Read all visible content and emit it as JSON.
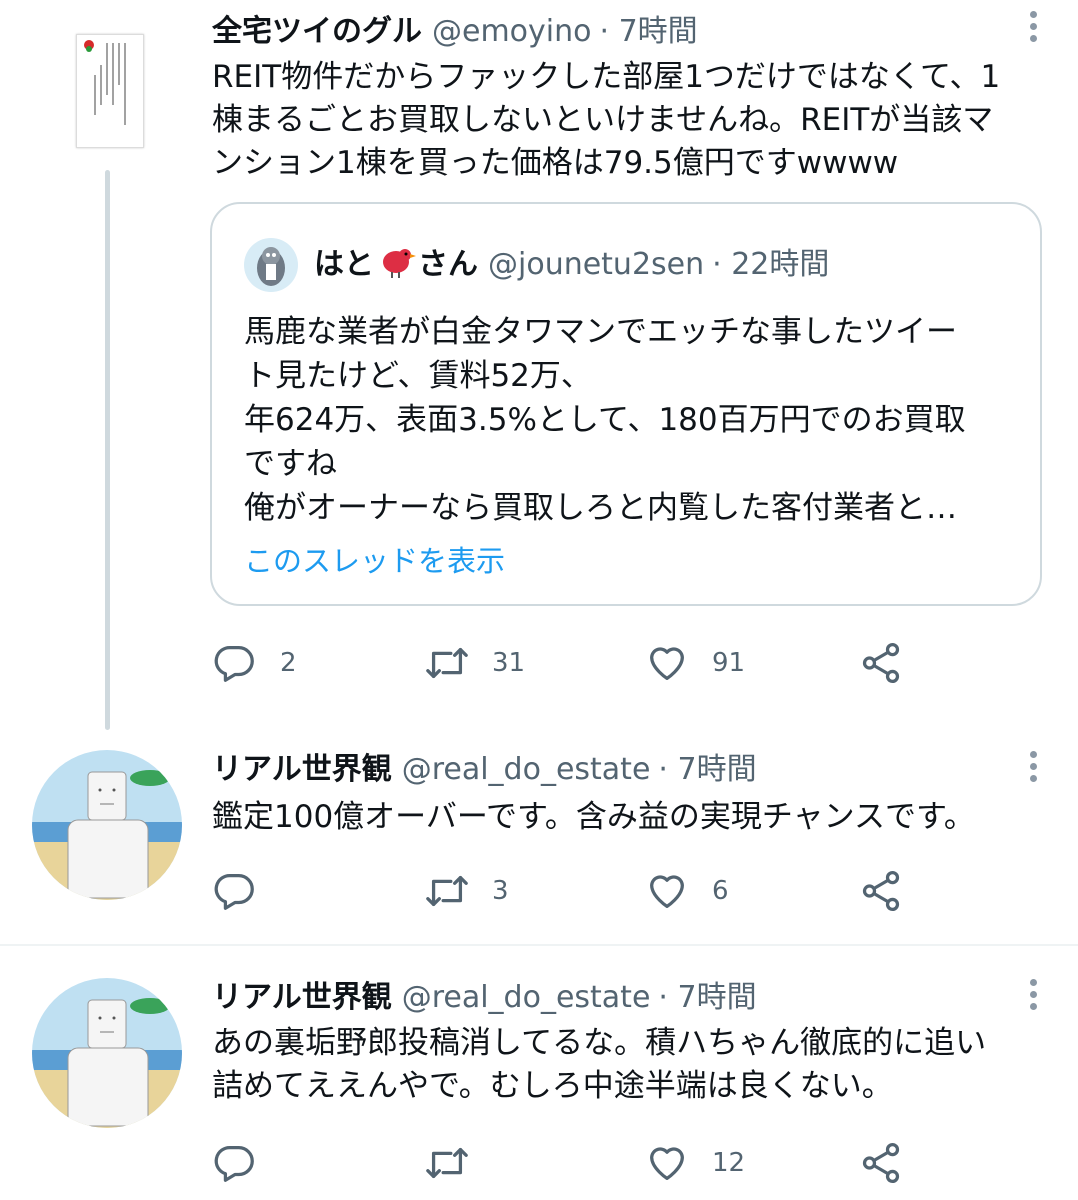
{
  "tweets": [
    {
      "name": "全宅ツイのグル",
      "handle": "@emoyino",
      "time": "· 7時間",
      "text_lines": [
        "REIT物件だからファックした部屋1つだけではなくて、1",
        "棟まるごとお買取しないといけませんね。REITが当該マ",
        "ンション1棟を買った価格は79.5億円ですwwww"
      ],
      "quote": {
        "name": "はと",
        "name_suffix": "さん",
        "handle": "@jounetu2sen",
        "time": "· 22時間",
        "lines": [
          "馬鹿な業者が白金タワマンでエッチな事したツイー",
          "ト見たけど、賃料52万、",
          "年624万、表面3.5%として、180百万円でのお買取",
          "ですね",
          "俺がオーナーなら買取しろと内覧した客付業者と…"
        ],
        "show_thread": "このスレッドを表示"
      },
      "replies": "2",
      "retweets": "31",
      "likes": "91"
    },
    {
      "name": "リアル世界観",
      "handle": "@real_do_estate",
      "time": "· 7時間",
      "text_lines": [
        "鑑定100億オーバーです。含み益の実現チャンスです。"
      ],
      "replies": "",
      "retweets": "3",
      "likes": "6"
    },
    {
      "name": "リアル世界観",
      "handle": "@real_do_estate",
      "time": "· 7時間",
      "text_lines": [
        "あの裏垢野郎投稿消してるな。積ハちゃん徹底的に追い",
        "詰めてええんやで。むしろ中途半端は良くない。"
      ],
      "replies": "",
      "retweets": "",
      "likes": "12"
    }
  ],
  "icons": [
    "reply-icon",
    "retweet-icon",
    "like-icon",
    "share-icon",
    "more-icon"
  ],
  "colors": {
    "link": "#1d9bf0",
    "secondary": "#536471",
    "border": "#cfd9de",
    "text": "#0f1419"
  }
}
